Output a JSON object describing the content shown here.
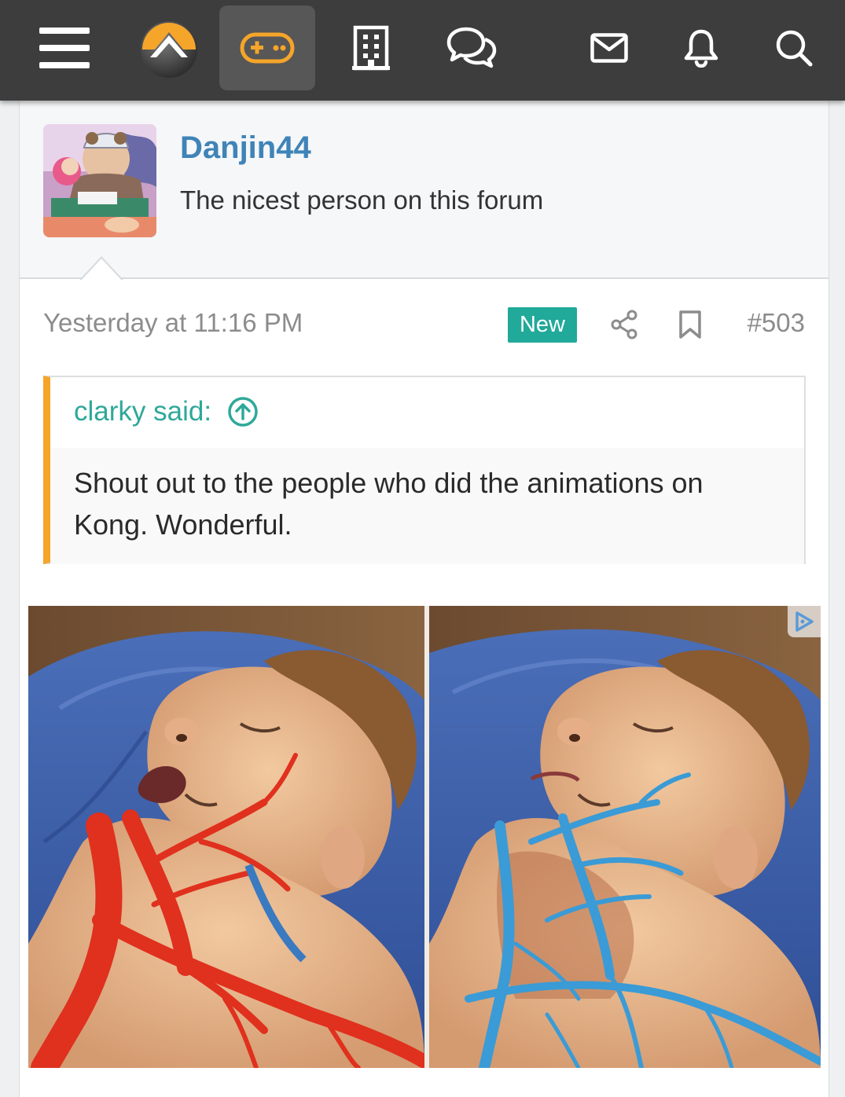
{
  "nav": {
    "icons": [
      "menu-icon",
      "site-logo",
      "gamepad-icon",
      "building-icon",
      "chat-bubbles-icon",
      "mail-icon",
      "bell-icon",
      "search-icon"
    ],
    "active": "gamepad-icon",
    "colors": {
      "bar": "#3d3d3d",
      "active_bg": "#575757",
      "accent_orange": "#f5a52a"
    }
  },
  "user": {
    "name": "Danjin44",
    "title": "The nicest person on this forum"
  },
  "post": {
    "timestamp": "Yesterday at 11:16 PM",
    "new_badge": "New",
    "number": "#503",
    "actions": [
      "share-icon",
      "bookmark-icon"
    ]
  },
  "quote": {
    "author_line": "clarky said:",
    "text": "Shout out to the people who did the animations on Kong. Wonderful."
  },
  "colors": {
    "username": "#3f84b8",
    "new_badge": "#21a99a",
    "quote_author": "#2fa899",
    "quote_bar": "#f5a52a",
    "artery": "#e0301e",
    "vein": "#3a9bd6"
  }
}
